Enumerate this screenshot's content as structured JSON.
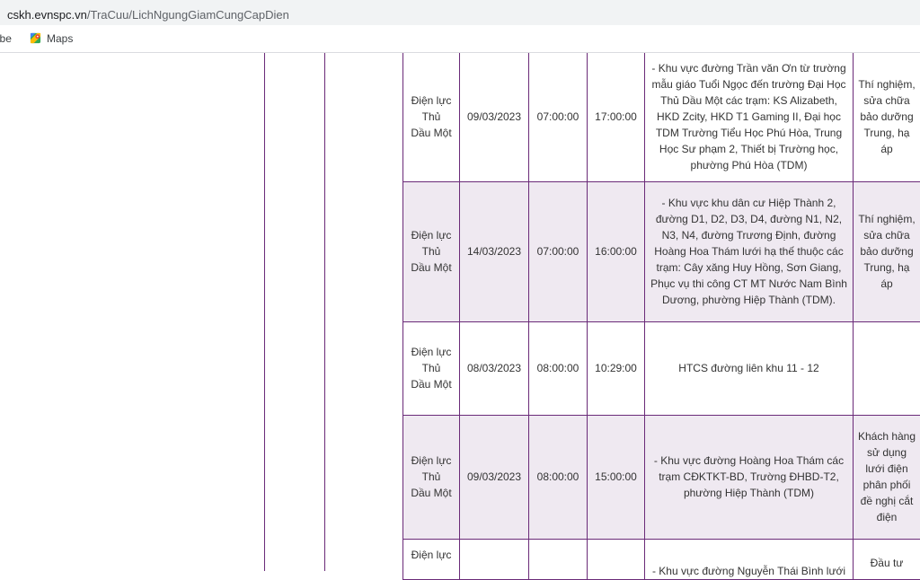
{
  "browser": {
    "url_domain": "cskh.evnspc.vn",
    "url_path": "/TraCuu/LichNgungGiamCungCapDien",
    "bookmarks": [
      {
        "label": "Tube"
      },
      {
        "label": "Maps"
      }
    ]
  },
  "table": {
    "rows": [
      {
        "unit": "Điện lực Thủ Dầu Một",
        "date": "09/03/2023",
        "start": "07:00:00",
        "end": "17:00:00",
        "area": "- Khu vực đường Trần văn Ơn từ trường mẫu giáo Tuổi Ngọc đến trường Đại Học Thủ Dầu Một các trạm: KS Alizabeth, HKD Zcity, HKD T1 Gaming II, Đại học TDM Trường Tiểu Học Phú Hòa, Trung Học Sư phạm 2, Thiết bị Trường học, phường Phú Hòa (TDM)",
        "reason": "Thí nghiệm, sửa chữa bảo dưỡng Trung, hạ áp"
      },
      {
        "unit": "Điện lực Thủ Dầu Một",
        "date": "14/03/2023",
        "start": "07:00:00",
        "end": "16:00:00",
        "area": "- Khu vực khu dân cư Hiệp Thành 2, đường D1, D2, D3, D4, đường N1, N2, N3, N4, đường Trương Định, đường Hoàng Hoa Thám lưới hạ thế thuộc các trạm: Cây xăng Huy Hồng, Sơn Giang, Phục vụ thi công CT MT Nước Nam Bình Dương, phường Hiệp Thành (TDM).",
        "reason": "Thí nghiệm, sửa chữa bảo dưỡng Trung, hạ áp"
      },
      {
        "unit": "Điện lực Thủ Dầu Một",
        "date": "08/03/2023",
        "start": "08:00:00",
        "end": "10:29:00",
        "area": "HTCS đường liên khu 11 - 12",
        "reason": ""
      },
      {
        "unit": "Điện lực Thủ Dầu Một",
        "date": "09/03/2023",
        "start": "08:00:00",
        "end": "15:00:00",
        "area": "- Khu vực đường Hoàng Hoa Thám các trạm CĐKTKT-BD, Trường ĐHBD-T2, phường Hiệp Thành (TDM)",
        "reason": "Khách hàng sử dụng lưới điện phân phối đề nghị cắt điện"
      },
      {
        "unit": "Điện lực",
        "date": "",
        "start": "",
        "end": "",
        "area": "- Khu vực đường Nguyễn Thái Bình lưới",
        "reason": "Đầu tư"
      }
    ]
  }
}
